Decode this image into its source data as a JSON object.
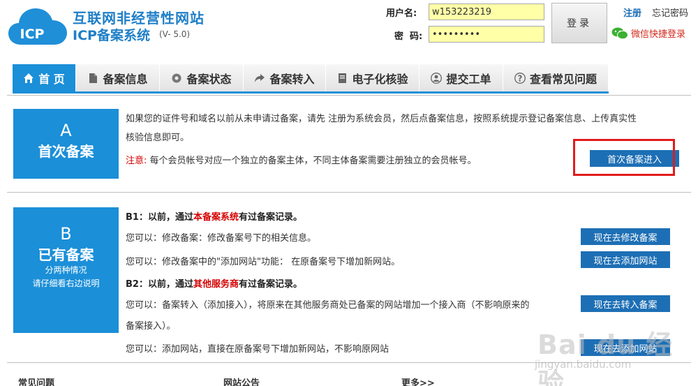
{
  "header": {
    "logo_text": "ICP",
    "title": "互联网非经营性网站",
    "subtitle": "ICP备案系统",
    "version": "(V- 5.0)",
    "username_label": "用户名:",
    "username_value": "w153223219",
    "password_label": "密  码:",
    "password_value": "•••••••••",
    "login_label": "登录",
    "register_label": "注册",
    "forgot_label": "忘记密码",
    "wechat_label": "微信快捷登录"
  },
  "nav": {
    "tabs": [
      {
        "label": "首 页",
        "icon": "home-icon",
        "active": true
      },
      {
        "label": "备案信息",
        "icon": "document-icon"
      },
      {
        "label": "备案状态",
        "icon": "gear-icon"
      },
      {
        "label": "备案转入",
        "icon": "share-arrow-icon"
      },
      {
        "label": "电子化核验",
        "icon": "notebook-icon"
      },
      {
        "label": "提交工单",
        "icon": "user-icon"
      },
      {
        "label": "查看常见问题",
        "icon": "question-icon"
      }
    ]
  },
  "section_a": {
    "letter": "A",
    "name": "首次备案",
    "desc_line1": "如果您的证件号和域名以前从未申请过备案，请先 注册为系统会员，然后点备案信息，按照系统提示登记备案信息、上传真实性",
    "desc_line2": "核验信息即可。",
    "notice_label": "注意:",
    "notice_text": "每个会员帐号对应一个独立的备案主体，不同主体备案需要注册独立的会员帐号。",
    "button": "首次备案进入"
  },
  "section_b": {
    "letter": "B",
    "name": "已有备案",
    "note1": "分两种情况",
    "note2": "请仔细看右边说明",
    "b1_pre": "B1：以前，通过",
    "b1_highlight": "本备案系统",
    "b1_post": "有过备案记录。",
    "b1_line1": "您可以：修改备案：修改备案号下的相关信息。",
    "b1_line2": "您可以：修改备案中的\"添加网站\"功能： 在原备案号下增加新网站。",
    "b2_pre": "B2：以前，通过",
    "b2_highlight": "其他服务商",
    "b2_post": "有过备案记录。",
    "b2_line1a": "您可以：备案转入（添加接入），将原来在其他服务商处已备案的网站增加一个接入商（不影响原来的",
    "b2_line1b": "备案接入）。",
    "b2_line2": "您可以：添加网站，直接在原备案号下增加新网站，不影响原网站",
    "btn_modify": "现在去修改备案",
    "btn_add_site": "现在去添加网站",
    "btn_transfer": "现在去转入备案",
    "btn_add_site2": "现在去添加网站"
  },
  "bottom": {
    "faq": "常见问题",
    "notice": "网站公告",
    "more": "更多>>"
  },
  "watermark": {
    "brand": "Bai du 经验",
    "url": "jingyan.baidu.com"
  },
  "colors": {
    "brand_blue": "#1b8fd8",
    "button_blue": "#1d6fb5",
    "highlight_red": "#d40000",
    "input_yellow": "#ffffa8"
  }
}
